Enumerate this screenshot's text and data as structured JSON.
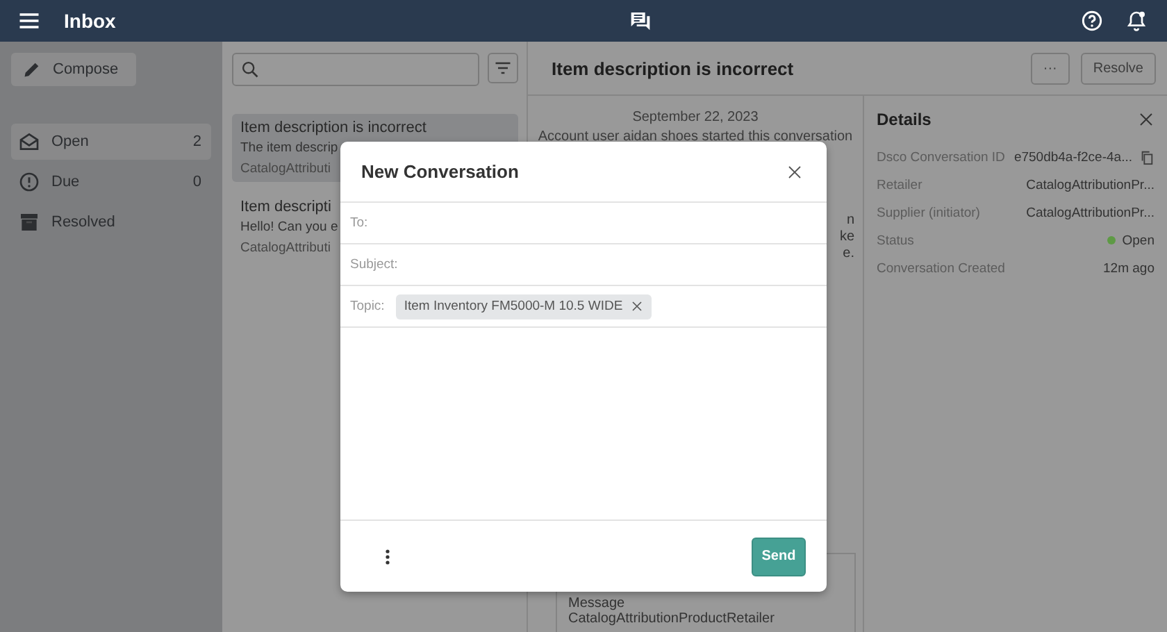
{
  "app_bar": {
    "title": "Inbox"
  },
  "sidebar": {
    "compose_label": "Compose",
    "items": [
      {
        "label": "Open",
        "count": "2",
        "selected": true,
        "kind": "open"
      },
      {
        "label": "Due",
        "count": "0",
        "selected": false,
        "kind": "due"
      },
      {
        "label": "Resolved",
        "selected": false,
        "kind": "resolved"
      }
    ]
  },
  "conversation_list": {
    "items": [
      {
        "title": "Item description is incorrect",
        "preview": "The item descrip",
        "sender": "CatalogAttributi",
        "selected": true
      },
      {
        "title": "Item descripti",
        "preview": "Hello! Can you e",
        "sender": "CatalogAttributi",
        "selected": false
      }
    ]
  },
  "conversation": {
    "title": "Item description is incorrect",
    "more_label": "···",
    "resolve_label": "Resolve",
    "date": "September 22, 2023",
    "event": "Account user aidan shoes started this conversation",
    "message_fragment": [
      "n",
      "ke",
      "e."
    ],
    "bottom_message": [
      "Message",
      "CatalogAttributionProductRetailer"
    ]
  },
  "details": {
    "title": "Details",
    "rows": [
      {
        "label": "Dsco Conversation ID",
        "value": "e750db4a-f2ce-4a...",
        "kind": "copy"
      },
      {
        "label": "Retailer",
        "value": "CatalogAttributionPr...",
        "kind": "text"
      },
      {
        "label": "Supplier (initiator)",
        "value": "CatalogAttributionPr...",
        "kind": "text"
      },
      {
        "label": "Status",
        "value": "Open",
        "kind": "status",
        "color": "#5e9a45"
      },
      {
        "label": "Conversation Created",
        "value": "12m ago",
        "kind": "text"
      }
    ]
  },
  "dialog": {
    "title": "New Conversation",
    "fields": [
      {
        "label": "To:",
        "kind": "text"
      },
      {
        "label": "Subject:",
        "kind": "text"
      },
      {
        "label": "Topic:",
        "kind": "chips",
        "chips": [
          "Item Inventory FM5000-M 10.5 WIDE"
        ]
      }
    ],
    "send_label": "Send"
  }
}
